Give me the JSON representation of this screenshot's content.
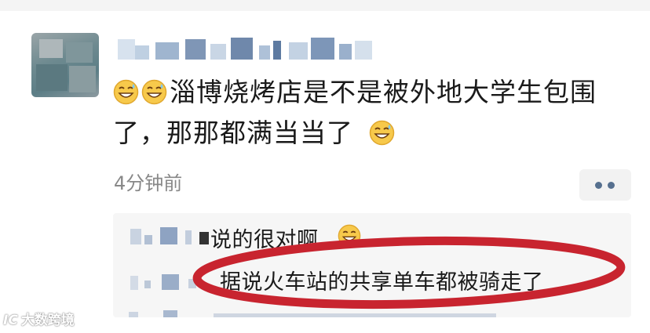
{
  "post": {
    "line1": "淄博烧烤店是不是被外地大学生包围",
    "line2": "了，那那都满当当了",
    "timestamp": "4分钟前"
  },
  "comments": [
    {
      "text": "说的很对啊"
    },
    {
      "text": "据说火车站的共享单车都被骑走了"
    }
  ],
  "watermark": {
    "logo": "IC",
    "text": "大数跨境"
  },
  "icons": {
    "emoji": "grinning-sweat-emoji",
    "more": "more-dots-icon"
  },
  "colors": {
    "highlight": "#c8242f",
    "link": "#56708f"
  }
}
